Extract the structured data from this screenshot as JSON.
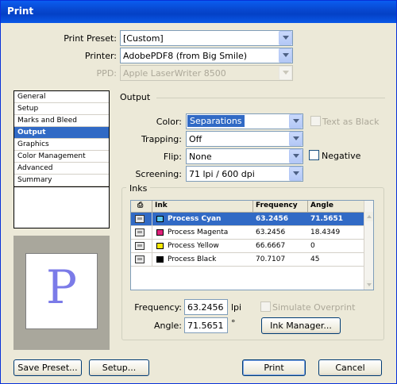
{
  "window": {
    "title": "Print"
  },
  "top_fields": {
    "print_preset": {
      "label": "Print Preset:",
      "value": "[Custom]"
    },
    "printer": {
      "label": "Printer:",
      "value": "AdobePDF8 (from Big Smile)"
    },
    "ppd": {
      "label": "PPD:",
      "value": "Apple LaserWriter 8500"
    }
  },
  "sidebar": {
    "items": [
      {
        "label": "General"
      },
      {
        "label": "Setup"
      },
      {
        "label": "Marks and Bleed"
      },
      {
        "label": "Output"
      },
      {
        "label": "Graphics"
      },
      {
        "label": "Color Management"
      },
      {
        "label": "Advanced"
      },
      {
        "label": "Summary"
      }
    ],
    "active": "Output"
  },
  "preview": {
    "letter": "P"
  },
  "output": {
    "section_title": "Output",
    "color": {
      "label": "Color:",
      "value": "Separations"
    },
    "text_as_black": {
      "label": "Text as Black",
      "checked": false
    },
    "trapping": {
      "label": "Trapping:",
      "value": "Off"
    },
    "flip": {
      "label": "Flip:",
      "value": "None"
    },
    "negative": {
      "label": "Negative",
      "checked": false
    },
    "screening": {
      "label": "Screening:",
      "value": "71 lpi / 600 dpi"
    }
  },
  "inks": {
    "group_label": "Inks",
    "columns": [
      "Ink",
      "Frequency",
      "Angle"
    ],
    "rows": [
      {
        "ink": "Process Cyan",
        "frequency": "63.2456",
        "angle": "71.5651",
        "swatch": "#5bc8f0",
        "selected": true
      },
      {
        "ink": "Process Magenta",
        "frequency": "63.2456",
        "angle": "18.4349",
        "swatch": "#e0207a",
        "selected": false
      },
      {
        "ink": "Process Yellow",
        "frequency": "66.6667",
        "angle": "0",
        "swatch": "#f8e800",
        "selected": false
      },
      {
        "ink": "Process Black",
        "frequency": "70.7107",
        "angle": "45",
        "swatch": "#000000",
        "selected": false
      }
    ],
    "frequency": {
      "label": "Frequency:",
      "value": "63.2456",
      "unit": "lpi"
    },
    "angle": {
      "label": "Angle:",
      "value": "71.5651",
      "unit": "°"
    },
    "simulate_overprint": {
      "label": "Simulate Overprint",
      "checked": false
    },
    "ink_manager_label": "Ink Manager..."
  },
  "buttons": {
    "save_preset": "Save Preset...",
    "setup": "Setup...",
    "print": "Print",
    "cancel": "Cancel"
  }
}
